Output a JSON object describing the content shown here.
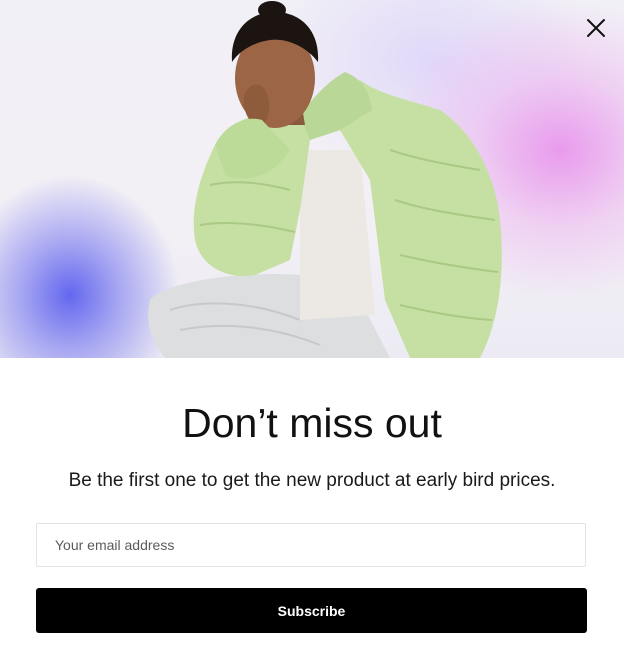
{
  "popup": {
    "hero_image": {
      "alt_subject": "model-in-green-puffer-jacket"
    },
    "close_icon": "close-icon",
    "title": "Don’t miss out",
    "subtitle": "Be the first one to get the new product at early bird prices.",
    "email_input": {
      "value": "",
      "placeholder": "Your email address"
    },
    "subscribe_label": "Subscribe"
  },
  "colors": {
    "background": "#ffffff",
    "button_bg": "#000000",
    "button_text": "#ffffff",
    "jacket_green": "#c9e3a8",
    "gradient_blue": "#5c60ee",
    "gradient_pink": "#e896ec"
  }
}
